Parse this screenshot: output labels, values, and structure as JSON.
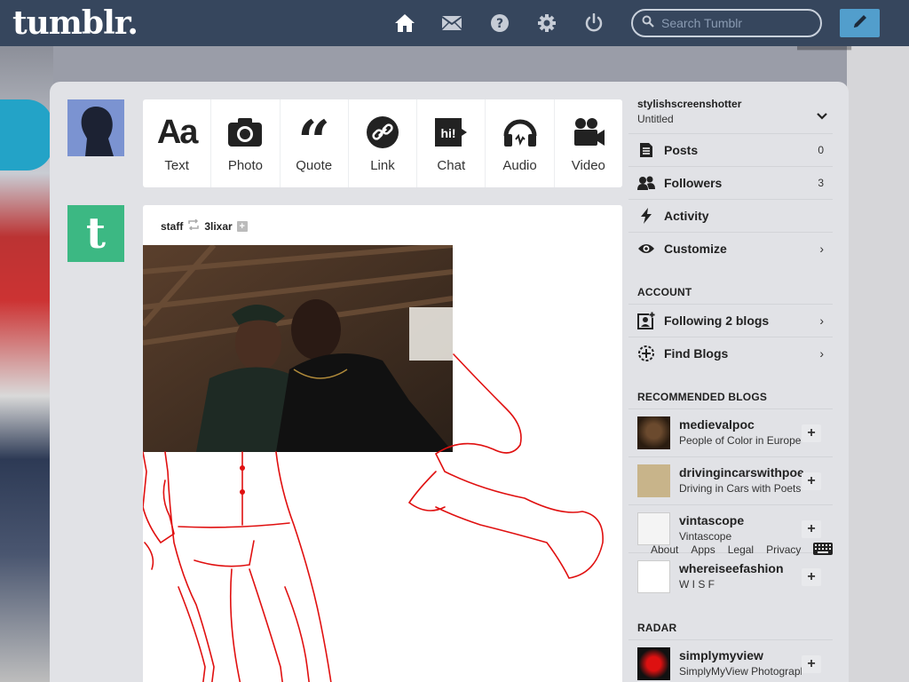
{
  "header": {
    "logo": "tumblr.",
    "nav": [
      {
        "name": "home-icon",
        "label": "Dashboard",
        "active": true
      },
      {
        "name": "mail-icon",
        "label": "Inbox"
      },
      {
        "name": "help-icon",
        "label": "Help"
      },
      {
        "name": "gear-icon",
        "label": "Settings"
      },
      {
        "name": "power-icon",
        "label": "Log out"
      }
    ],
    "search_placeholder": "Search Tumblr",
    "compose_icon": "pencil-icon"
  },
  "post_types": [
    {
      "label": "Text",
      "icon": "text-icon"
    },
    {
      "label": "Photo",
      "icon": "camera-icon"
    },
    {
      "label": "Quote",
      "icon": "quote-icon"
    },
    {
      "label": "Link",
      "icon": "link-icon"
    },
    {
      "label": "Chat",
      "icon": "chat-icon"
    },
    {
      "label": "Audio",
      "icon": "headphones-icon"
    },
    {
      "label": "Video",
      "icon": "video-camera-icon"
    }
  ],
  "post": {
    "author": "staff",
    "reblogged_from": "3lixar"
  },
  "sidebar": {
    "blog_name": "stylishscreenshotter",
    "blog_title": "Untitled",
    "stats": [
      {
        "label": "Posts",
        "count": "0",
        "icon": "posts-icon"
      },
      {
        "label": "Followers",
        "count": "3",
        "icon": "followers-icon"
      },
      {
        "label": "Activity",
        "count": "",
        "icon": "lightning-icon"
      },
      {
        "label": "Customize",
        "count": "",
        "icon": "eye-icon"
      }
    ],
    "account_title": "ACCOUNT",
    "account_items": [
      {
        "label": "Following 2 blogs",
        "icon": "following-icon"
      },
      {
        "label": "Find Blogs",
        "icon": "find-blogs-icon"
      }
    ],
    "recommended_title": "RECOMMENDED BLOGS",
    "recommended": [
      {
        "name": "medievalpoc",
        "desc": "People of Color in European Art History"
      },
      {
        "name": "drivingincarswithpoets",
        "desc": "Driving in Cars with Poets"
      },
      {
        "name": "vintascope",
        "desc": "Vintascope"
      },
      {
        "name": "whereiseefashion",
        "desc": "W I S F"
      }
    ],
    "radar_title": "RADAR",
    "radar": [
      {
        "name": "simplymyview",
        "desc": "SimplyMyView Photography"
      }
    ],
    "footer_links": [
      "About",
      "Apps",
      "Legal",
      "Privacy"
    ]
  },
  "colors": {
    "header_bg": "#36465d",
    "compose_bg": "#529ecc",
    "blog_avatar_bg": "#3cb883",
    "sketch_stroke": "#e01010"
  }
}
